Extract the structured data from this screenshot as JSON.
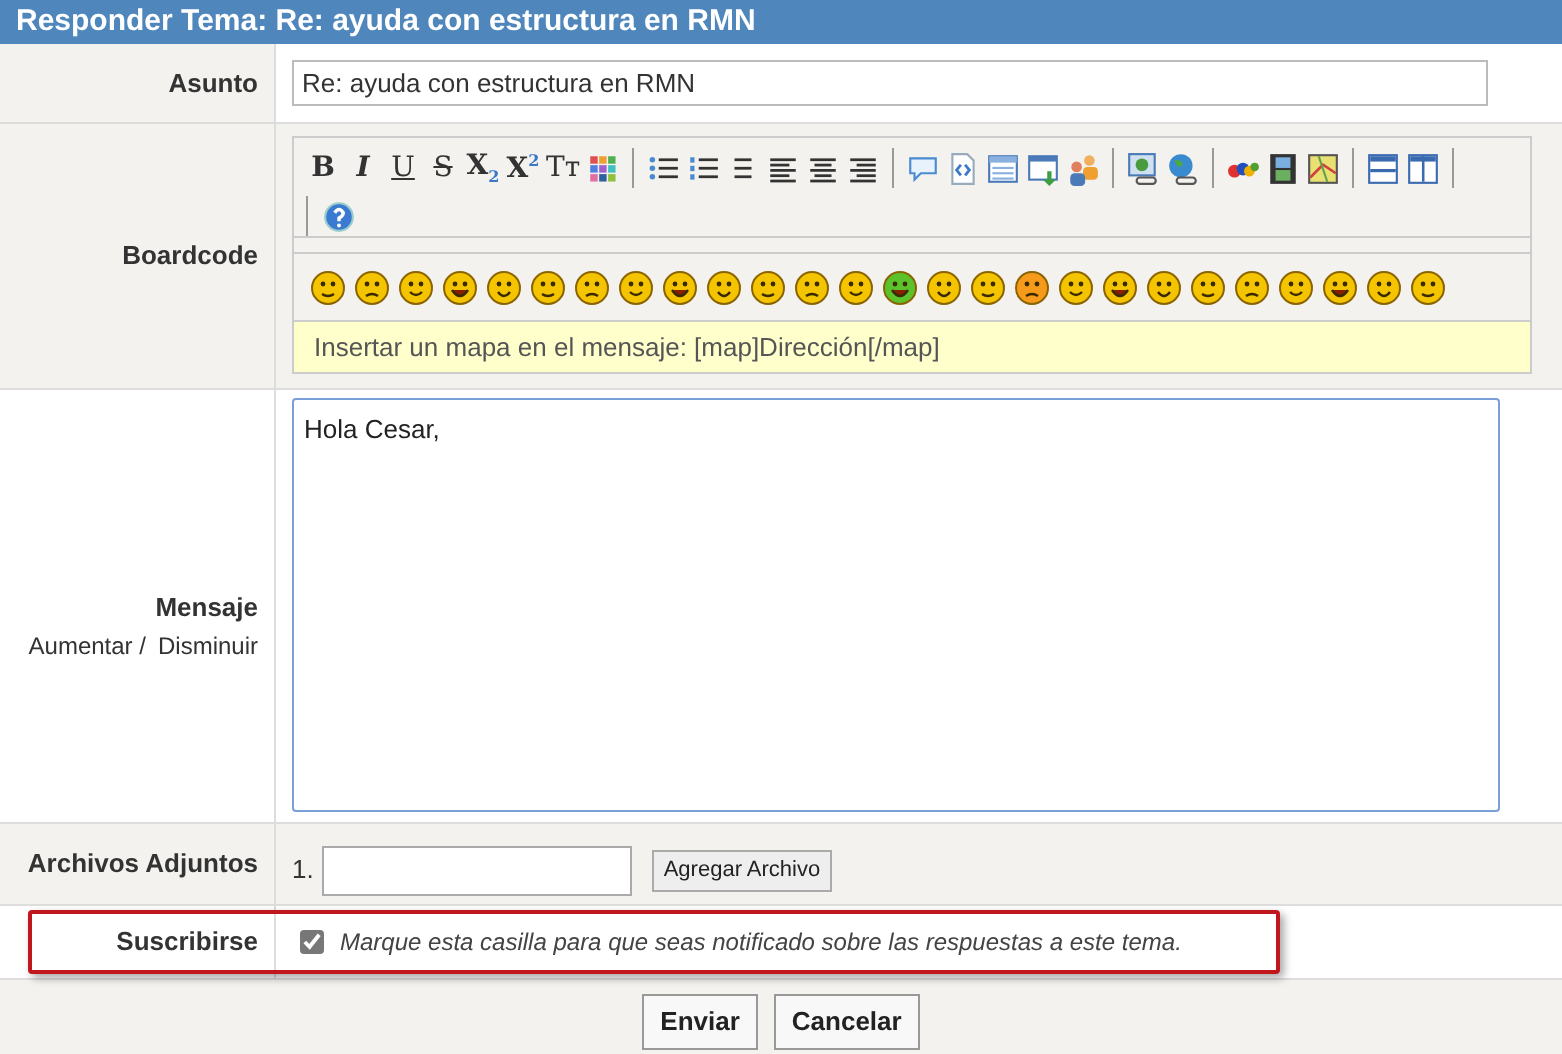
{
  "header": {
    "title": "Responder Tema: Re: ayuda con estructura en RMN"
  },
  "subject": {
    "label": "Asunto",
    "value": "Re: ayuda con estructura en RMN"
  },
  "boardcode": {
    "label": "Boardcode",
    "toolbar": [
      {
        "kind": "bold",
        "label": "B"
      },
      {
        "kind": "italic",
        "label": "I"
      },
      {
        "kind": "underline",
        "label": "U"
      },
      {
        "kind": "strike",
        "label": "S"
      },
      {
        "kind": "sub",
        "label": "X",
        "small": "2"
      },
      {
        "kind": "sup",
        "label": "X",
        "small": "2"
      },
      {
        "kind": "tt",
        "label": "Tт"
      },
      {
        "kind": "colors"
      },
      {
        "kind": "sep"
      },
      {
        "kind": "bullets"
      },
      {
        "kind": "numbers"
      },
      {
        "kind": "rule"
      },
      {
        "kind": "left"
      },
      {
        "kind": "center"
      },
      {
        "kind": "right"
      },
      {
        "kind": "sep"
      },
      {
        "kind": "quote"
      },
      {
        "kind": "code"
      },
      {
        "kind": "table"
      },
      {
        "kind": "window"
      },
      {
        "kind": "people"
      },
      {
        "kind": "sep"
      },
      {
        "kind": "imagelink"
      },
      {
        "kind": "globelink"
      },
      {
        "kind": "sep"
      },
      {
        "kind": "ebay"
      },
      {
        "kind": "film"
      },
      {
        "kind": "map"
      },
      {
        "kind": "sep"
      },
      {
        "kind": "rows"
      },
      {
        "kind": "cols"
      },
      {
        "kind": "sep"
      },
      {
        "kind": "help"
      }
    ],
    "map_hint": "Insertar un mapa en el mensaje: [map]Dirección[/map]"
  },
  "message": {
    "label": "Mensaje",
    "enlarge": "Aumentar /",
    "shrink": "Disminuir",
    "value": "Hola Cesar, "
  },
  "attachments": {
    "label": "Archivos Adjuntos",
    "index": "1.",
    "button": "Agregar Archivo"
  },
  "subscribe": {
    "label": "Suscribirse",
    "checked": true,
    "text": "Marque esta casilla para que seas notificado sobre las respuestas a este tema."
  },
  "buttons": [
    "Enviar",
    "Cancelar"
  ]
}
